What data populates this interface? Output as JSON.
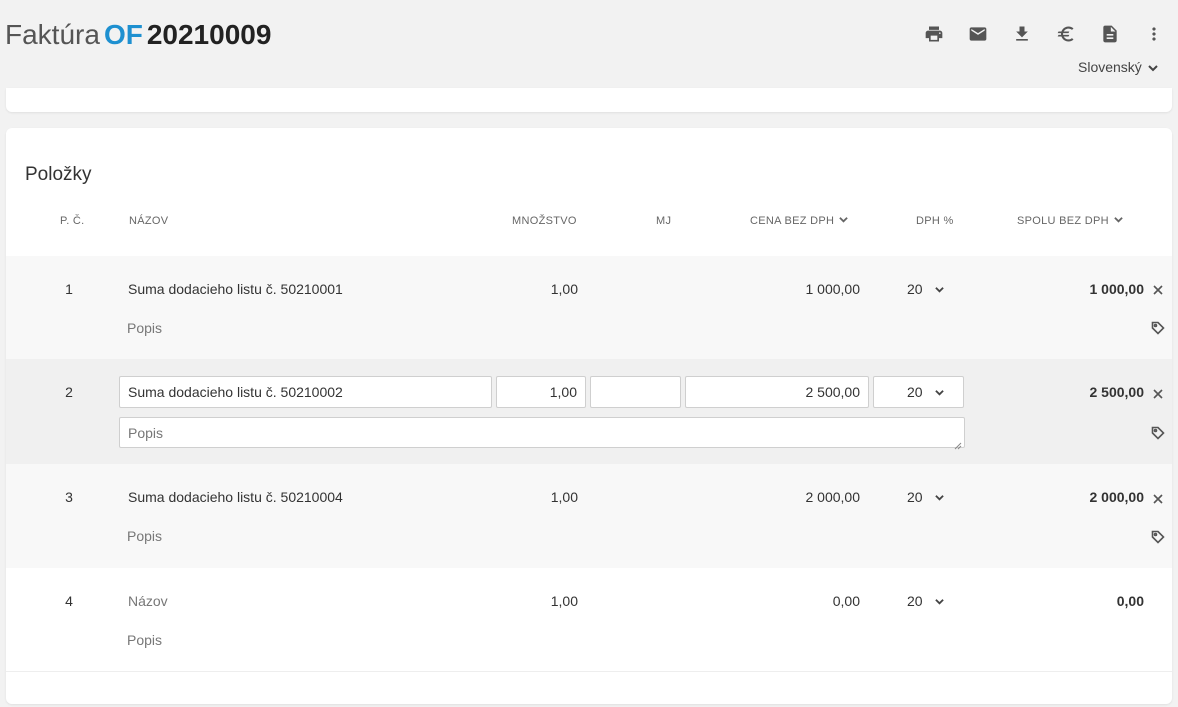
{
  "header": {
    "doc_type": "Faktúra",
    "prefix": "OF",
    "number": "20210009",
    "toolbar": [
      {
        "name": "print-icon",
        "label": "print"
      },
      {
        "name": "mail-icon",
        "label": "mail"
      },
      {
        "name": "download-icon",
        "label": "download"
      },
      {
        "name": "euro-icon",
        "label": "€"
      },
      {
        "name": "document-icon",
        "label": "document"
      },
      {
        "name": "more-icon",
        "label": "more"
      }
    ],
    "language": "Slovenský"
  },
  "items": {
    "title": "Položky",
    "columns": {
      "no": "P. Č.",
      "name": "NÁZOV",
      "qty": "MNOŽSTVO",
      "unit": "MJ",
      "price": "CENA BEZ DPH",
      "vat": "DPH %",
      "total": "SPOLU BEZ DPH"
    },
    "rows": [
      {
        "no": "1",
        "name": "Suma dodacieho listu č. 50210001",
        "desc": "Popis",
        "qty": "1,00",
        "unit": "",
        "price": "1 000,00",
        "vat": "20",
        "total": "1 000,00"
      },
      {
        "no": "2",
        "name": "Suma dodacieho listu č. 50210002",
        "desc": "Popis",
        "qty": "1,00",
        "unit": "",
        "price": "2 500,00",
        "vat": "20",
        "total": "2 500,00"
      },
      {
        "no": "3",
        "name": "Suma dodacieho listu č. 50210004",
        "desc": "Popis",
        "qty": "1,00",
        "unit": "",
        "price": "2 000,00",
        "vat": "20",
        "total": "2 000,00"
      },
      {
        "no": "4",
        "name": "Názov",
        "desc": "Popis",
        "qty": "1,00",
        "unit": "",
        "price": "0,00",
        "vat": "20",
        "total": "0,00"
      }
    ]
  }
}
